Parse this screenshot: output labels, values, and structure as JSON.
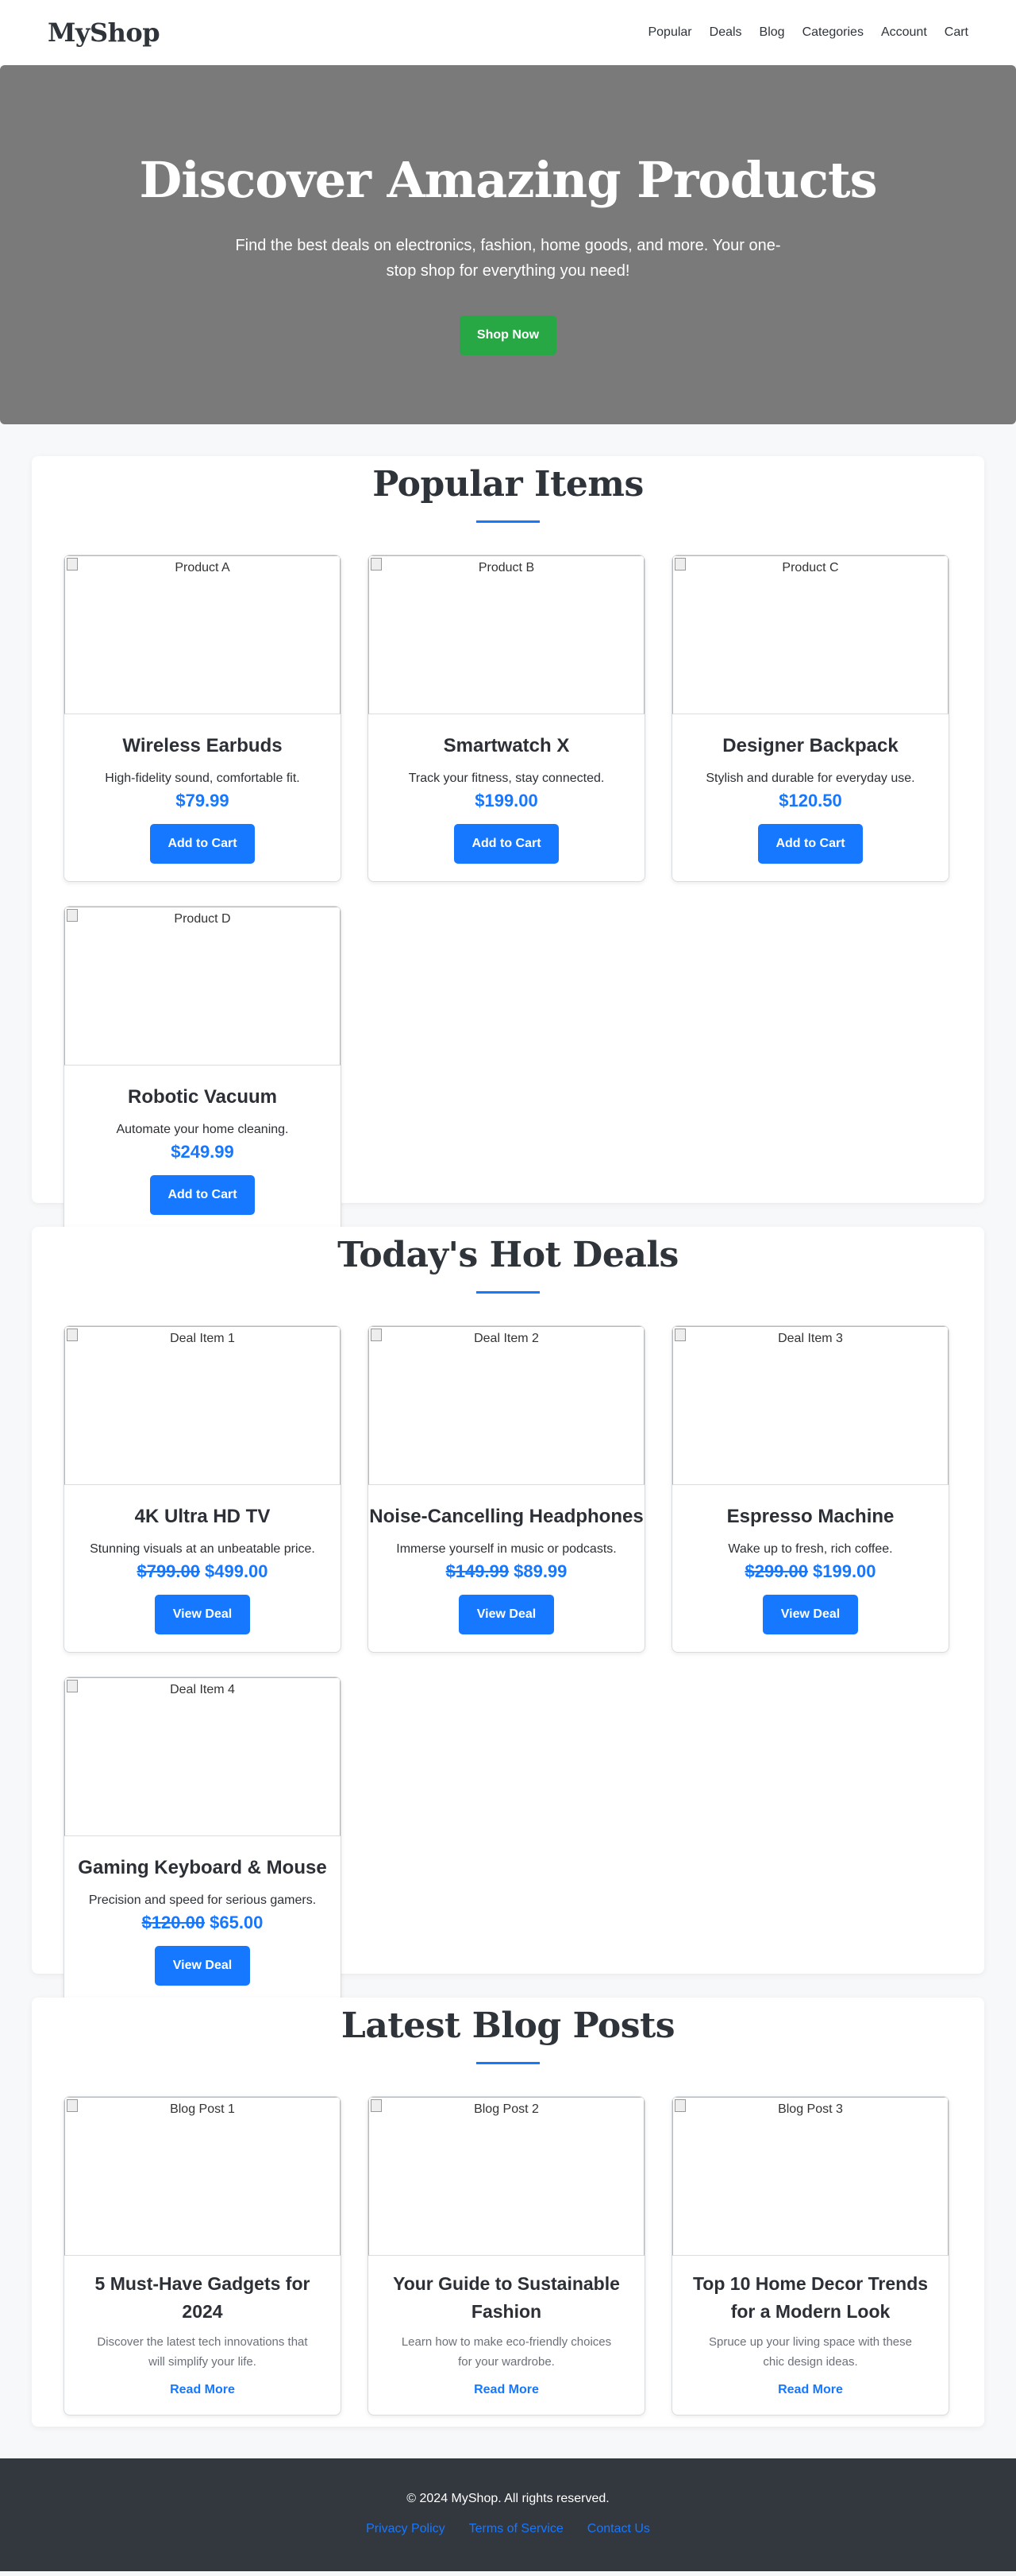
{
  "header": {
    "logo": "MyShop",
    "nav": [
      "Popular",
      "Deals",
      "Blog",
      "Categories",
      "Account",
      "Cart"
    ]
  },
  "hero": {
    "title": "Discover Amazing Products",
    "subtitle": "Find the best deals on electronics, fashion, home goods, and more. Your one-stop shop for everything you need!",
    "cta": "Shop Now"
  },
  "popular": {
    "title": "Popular Items",
    "button_label": "Add to Cart",
    "items": [
      {
        "img_alt": "Product A",
        "name": "Wireless Earbuds",
        "desc": "High-fidelity sound, comfortable fit.",
        "price": "$79.99"
      },
      {
        "img_alt": "Product B",
        "name": "Smartwatch X",
        "desc": "Track your fitness, stay connected.",
        "price": "$199.00"
      },
      {
        "img_alt": "Product C",
        "name": "Designer Backpack",
        "desc": "Stylish and durable for everyday use.",
        "price": "$120.50"
      },
      {
        "img_alt": "Product D",
        "name": "Robotic Vacuum",
        "desc": "Automate your home cleaning.",
        "price": "$249.99"
      }
    ]
  },
  "deals": {
    "title": "Today's Hot Deals",
    "button_label": "View Deal",
    "items": [
      {
        "img_alt": "Deal Item 1",
        "name": "4K Ultra HD TV",
        "desc": "Stunning visuals at an unbeatable price.",
        "old_price": "$799.00",
        "new_price": "$499.00"
      },
      {
        "img_alt": "Deal Item 2",
        "name": "Noise-Cancelling Headphones",
        "desc": "Immerse yourself in music or podcasts.",
        "old_price": "$149.99",
        "new_price": "$89.99"
      },
      {
        "img_alt": "Deal Item 3",
        "name": "Espresso Machine",
        "desc": "Wake up to fresh, rich coffee.",
        "old_price": "$299.00",
        "new_price": "$199.00"
      },
      {
        "img_alt": "Deal Item 4",
        "name": "Gaming Keyboard & Mouse",
        "desc": "Precision and speed for serious gamers.",
        "old_price": "$120.00",
        "new_price": "$65.00"
      }
    ]
  },
  "blog": {
    "title": "Latest Blog Posts",
    "link_label": "Read More",
    "posts": [
      {
        "img_alt": "Blog Post 1",
        "title": "5 Must-Have Gadgets for 2024",
        "desc": "Discover the latest tech innovations that will simplify your life."
      },
      {
        "img_alt": "Blog Post 2",
        "title": "Your Guide to Sustainable Fashion",
        "desc": "Learn how to make eco-friendly choices for your wardrobe."
      },
      {
        "img_alt": "Blog Post 3",
        "title": "Top 10 Home Decor Trends for a Modern Look",
        "desc": "Spruce up your living space with these chic design ideas."
      }
    ]
  },
  "footer": {
    "copyright": "© 2024 MyShop. All rights reserved.",
    "links": [
      "Privacy Policy",
      "Terms of Service",
      "Contact Us"
    ]
  },
  "colors": {
    "accent": "#1677ff",
    "cta_green": "#28a745",
    "hero_bg": "#7a7a7a",
    "footer_bg": "#33373e"
  }
}
